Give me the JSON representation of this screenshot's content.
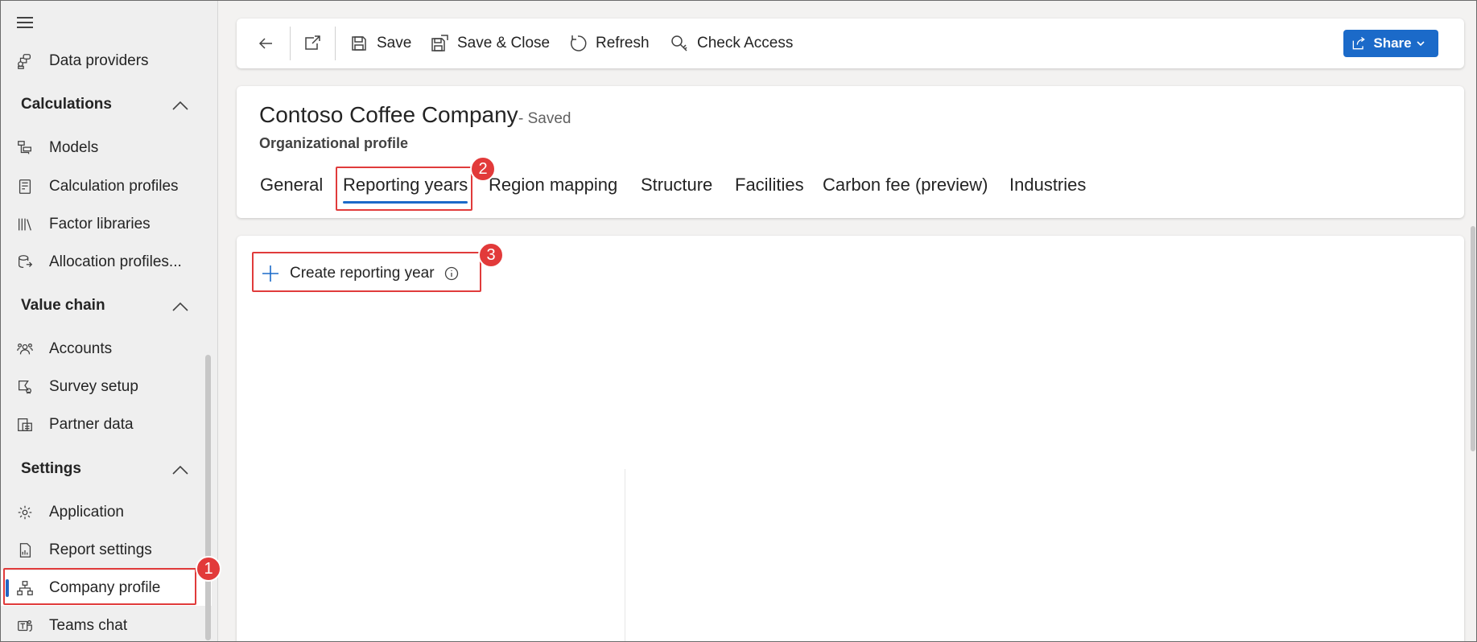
{
  "sidebar": {
    "items_top": [
      {
        "label": "Data providers",
        "icon": "data-providers-icon"
      }
    ],
    "sections": [
      {
        "title": "Calculations",
        "items": [
          {
            "label": "Models",
            "icon": "models-icon"
          },
          {
            "label": "Calculation profiles",
            "icon": "calculation-profiles-icon"
          },
          {
            "label": "Factor libraries",
            "icon": "factor-libraries-icon"
          },
          {
            "label": "Allocation profiles...",
            "icon": "allocation-profiles-icon"
          }
        ]
      },
      {
        "title": "Value chain",
        "items": [
          {
            "label": "Accounts",
            "icon": "accounts-icon"
          },
          {
            "label": "Survey setup",
            "icon": "survey-setup-icon"
          },
          {
            "label": "Partner data",
            "icon": "partner-data-icon"
          }
        ]
      },
      {
        "title": "Settings",
        "items": [
          {
            "label": "Application",
            "icon": "gear-icon"
          },
          {
            "label": "Report settings",
            "icon": "report-settings-icon"
          },
          {
            "label": "Company profile",
            "icon": "org-chart-icon"
          },
          {
            "label": "Teams chat",
            "icon": "teams-icon"
          }
        ]
      }
    ]
  },
  "toolbar": {
    "save_label": "Save",
    "save_close_label": "Save & Close",
    "refresh_label": "Refresh",
    "check_access_label": "Check Access",
    "share_label": "Share"
  },
  "record": {
    "title": "Contoso Coffee Company",
    "status": "- Saved",
    "subtitle": "Organizational profile",
    "tabs": [
      "General",
      "Reporting years",
      "Region mapping",
      "Structure",
      "Facilities",
      "Carbon fee (preview)",
      "Industries"
    ],
    "active_tab": "Reporting years"
  },
  "content": {
    "create_label": "Create reporting year"
  },
  "callouts": [
    "1",
    "2",
    "3"
  ],
  "colors": {
    "accent": "#1b6ac9",
    "callout": "#e03b3b"
  }
}
